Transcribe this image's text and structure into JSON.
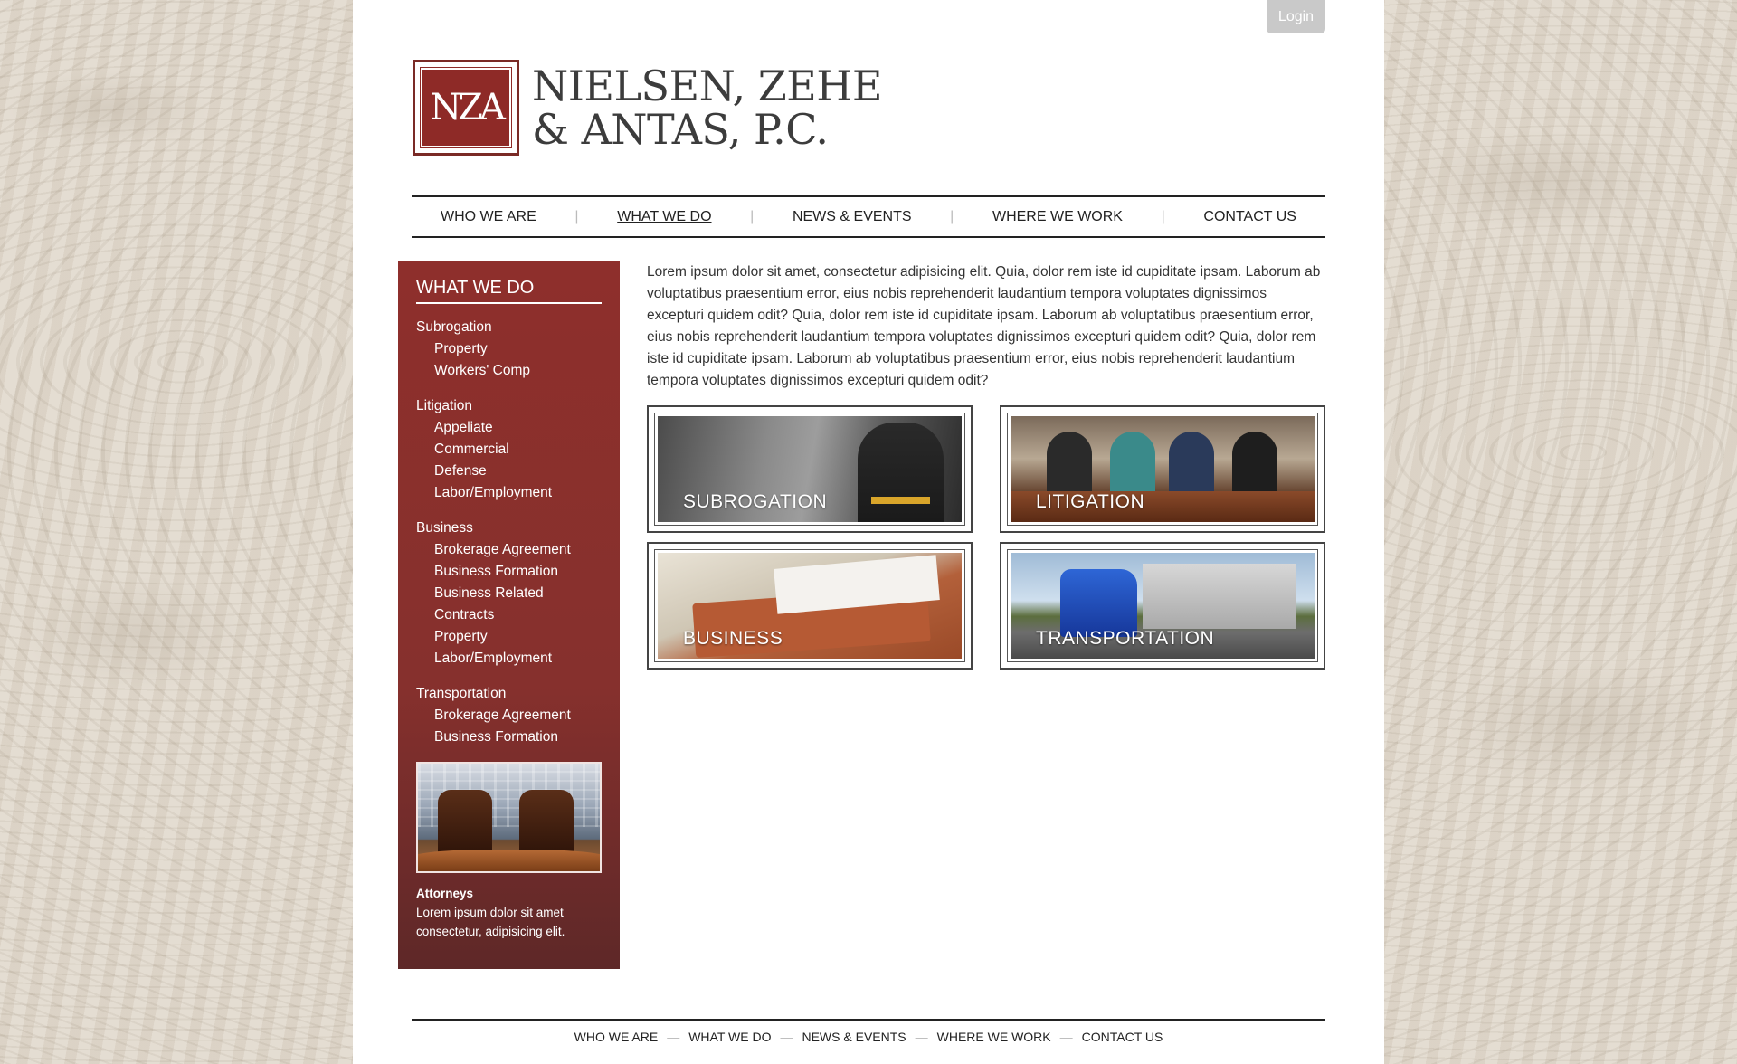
{
  "header": {
    "login_label": "Login",
    "logo": {
      "monogram": "NZA",
      "line1": "NIELSEN, ZEHE",
      "line2": "& ANTAS, P.C."
    }
  },
  "nav": {
    "items": [
      {
        "label": "WHO WE ARE",
        "active": false
      },
      {
        "label": "WHAT WE DO",
        "active": true
      },
      {
        "label": "NEWS & EVENTS",
        "active": false
      },
      {
        "label": "WHERE WE WORK",
        "active": false
      },
      {
        "label": "CONTACT US",
        "active": false
      }
    ],
    "separator": "|"
  },
  "sidebar": {
    "title": "WHAT WE DO",
    "groups": [
      {
        "label": "Subrogation",
        "items": [
          "Property",
          "Workers' Comp"
        ]
      },
      {
        "label": "Litigation",
        "items": [
          "Appeliate",
          "Commercial",
          "Defense",
          "Labor/Employment"
        ]
      },
      {
        "label": "Business",
        "items": [
          "Brokerage Agreement",
          "Business Formation",
          "Business Related",
          "Contracts",
          "Property",
          "Labor/Employment"
        ]
      },
      {
        "label": "Transportation",
        "items": [
          "Brokerage Agreement",
          "Business Formation"
        ]
      }
    ],
    "caption_title": "Attorneys",
    "caption_line1": "Lorem ipsum dolor sit amet",
    "caption_line2": "consectetur, adipisicing elit."
  },
  "main": {
    "intro": "Lorem ipsum dolor sit amet, consectetur adipisicing elit. Quia, dolor rem iste id cupiditate ipsam. Laborum ab voluptatibus praesentium error, eius nobis reprehenderit laudantium tempora voluptates dignissimos excepturi quidem odit? Quia, dolor rem iste id cupiditate ipsam. Laborum ab voluptatibus praesentium error, eius nobis reprehenderit laudantium tempora voluptates dignissimos excepturi quidem odit? Quia, dolor rem iste id cupiditate ipsam. Laborum ab voluptatibus praesentium error, eius nobis reprehenderit laudantium tempora voluptates dignissimos excepturi quidem odit?",
    "tiles": [
      {
        "label": "SUBROGATION"
      },
      {
        "label": "LITIGATION"
      },
      {
        "label": "BUSINESS"
      },
      {
        "label": "TRANSPORTATION"
      }
    ]
  },
  "footer": {
    "items": [
      "WHO WE ARE",
      "WHAT WE DO",
      "NEWS & EVENTS",
      "WHERE WE WORK",
      "CONTACT US"
    ],
    "separator": "—"
  },
  "colors": {
    "brand_red": "#8e2f2c",
    "login_bg": "#c9c9c9"
  }
}
